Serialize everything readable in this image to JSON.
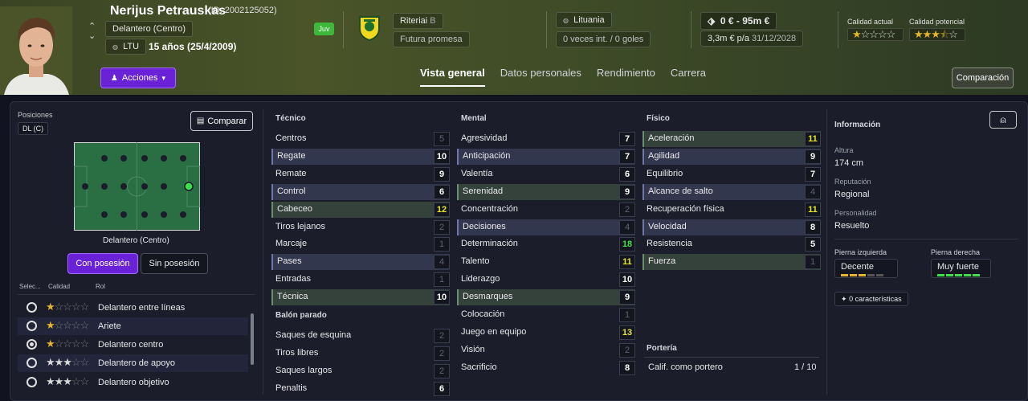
{
  "player": {
    "name": "Nerijus Petrauskas",
    "id": "(ID: 2002125052)",
    "position": "Delantero (Centro)",
    "nation_code": "LTU",
    "age": "15 años (25/4/2009)",
    "squad_badge": "Juv",
    "club": "Riteriai",
    "club_letter": "B",
    "status": "Futura promesa",
    "nationality": "Lituania",
    "caps": "0 veces int. / 0 goles",
    "value": "0 € - 95m €",
    "wage": "3,3m € p/a",
    "contract_end": "31/12/2028",
    "current_quality_label": "Calidad actual",
    "potential_quality_label": "Calidad potencial",
    "current_stars": 1,
    "potential_stars": 3.5
  },
  "header": {
    "actions_label": "Acciones",
    "tabs": [
      "Vista general",
      "Datos personales",
      "Rendimiento",
      "Carrera"
    ],
    "compare_label": "Comparación"
  },
  "positions_panel": {
    "title": "Posiciones",
    "badge": "DL (C)",
    "compare_btn": "Comparar",
    "pitch_caption": "Delantero (Centro)",
    "with_ball": "Con posesión",
    "without_ball": "Sin posesión",
    "col_select": "Selec...",
    "col_quality": "Calidad",
    "col_role": "Rol",
    "roles": [
      {
        "name": "Delantero entre líneas",
        "stars": 1,
        "selected": false
      },
      {
        "name": "Ariete",
        "stars": 1,
        "selected": false
      },
      {
        "name": "Delantero centro",
        "stars": 1,
        "selected": true
      },
      {
        "name": "Delantero de apoyo",
        "stars": 3,
        "selected": false
      },
      {
        "name": "Delantero objetivo",
        "stars": 3,
        "selected": false
      }
    ]
  },
  "technical": {
    "title": "Técnico",
    "attrs": [
      {
        "name": "Centros",
        "value": "5"
      },
      {
        "name": "Regate",
        "value": "10"
      },
      {
        "name": "Remate",
        "value": "9"
      },
      {
        "name": "Control",
        "value": "6"
      },
      {
        "name": "Cabeceo",
        "value": "12"
      },
      {
        "name": "Tiros lejanos",
        "value": "2"
      },
      {
        "name": "Marcaje",
        "value": "1"
      },
      {
        "name": "Pases",
        "value": "4"
      },
      {
        "name": "Entradas",
        "value": "1"
      },
      {
        "name": "Técnica",
        "value": "10"
      }
    ]
  },
  "set_pieces": {
    "title": "Balón parado",
    "attrs": [
      {
        "name": "Saques de esquina",
        "value": "2"
      },
      {
        "name": "Tiros libres",
        "value": "2"
      },
      {
        "name": "Saques largos",
        "value": "2"
      },
      {
        "name": "Penaltis",
        "value": "6"
      }
    ]
  },
  "mental": {
    "title": "Mental",
    "attrs": [
      {
        "name": "Agresividad",
        "value": "7"
      },
      {
        "name": "Anticipación",
        "value": "7"
      },
      {
        "name": "Valentía",
        "value": "6"
      },
      {
        "name": "Serenidad",
        "value": "9"
      },
      {
        "name": "Concentración",
        "value": "2"
      },
      {
        "name": "Decisiones",
        "value": "4"
      },
      {
        "name": "Determinación",
        "value": "18"
      },
      {
        "name": "Talento",
        "value": "11"
      },
      {
        "name": "Liderazgo",
        "value": "10"
      },
      {
        "name": "Desmarques",
        "value": "9"
      },
      {
        "name": "Colocación",
        "value": "1"
      },
      {
        "name": "Juego en equipo",
        "value": "13"
      },
      {
        "name": "Visión",
        "value": "2"
      },
      {
        "name": "Sacrificio",
        "value": "8"
      }
    ]
  },
  "physical": {
    "title": "Físico",
    "attrs": [
      {
        "name": "Aceleración",
        "value": "11"
      },
      {
        "name": "Agilidad",
        "value": "9"
      },
      {
        "name": "Equilibrio",
        "value": "7"
      },
      {
        "name": "Alcance de salto",
        "value": "4"
      },
      {
        "name": "Recuperación física",
        "value": "11"
      },
      {
        "name": "Velocidad",
        "value": "8"
      },
      {
        "name": "Resistencia",
        "value": "5"
      },
      {
        "name": "Fuerza",
        "value": "1"
      }
    ]
  },
  "goalkeeping": {
    "title": "Portería",
    "label": "Calif. como portero",
    "value": "1 / 10"
  },
  "info": {
    "title": "Información",
    "height_label": "Altura",
    "height": "174 cm",
    "reputation_label": "Reputación",
    "reputation": "Regional",
    "personality_label": "Personalidad",
    "personality": "Resuelto",
    "left_foot_label": "Pierna izquierda",
    "left_foot": "Decente",
    "right_foot_label": "Pierna derecha",
    "right_foot": "Muy fuerte",
    "traits": "0 características"
  },
  "colors": {
    "accent_purple": "#6a22d6",
    "highlight_green": "#3ee04a",
    "highlight_yellow": "#e6e42c",
    "star_gold": "#e4b52c"
  }
}
